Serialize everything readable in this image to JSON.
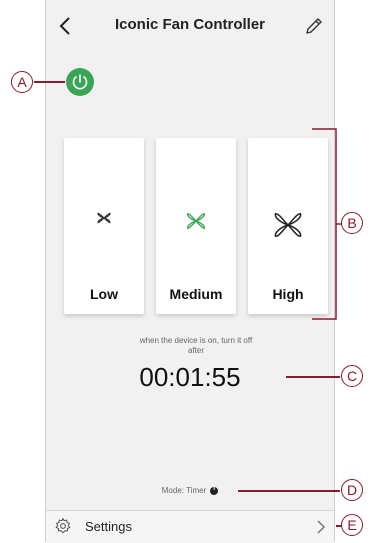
{
  "header": {
    "title": "Iconic Fan Controller",
    "back_icon": "chevron-left-icon",
    "edit_icon": "pencil-icon"
  },
  "power": {
    "icon": "power-icon",
    "state": "on",
    "color": "#3aa655"
  },
  "speeds": [
    {
      "label": "Low",
      "icon": "fan-low-icon",
      "color": "#333333",
      "selected": false
    },
    {
      "label": "Medium",
      "icon": "fan-medium-icon",
      "color": "#3aa655",
      "selected": true
    },
    {
      "label": "High",
      "icon": "fan-high-icon",
      "color": "#222222",
      "selected": false
    }
  ],
  "timer": {
    "note": "when the device is on, turn it off after",
    "value": "00:01:55"
  },
  "mode": {
    "text": "Mode: Timer",
    "icon": "info-icon"
  },
  "settings": {
    "label": "Settings",
    "icon": "gear-icon",
    "chevron": "chevron-right-icon"
  },
  "callouts": {
    "A": "A",
    "B": "B",
    "C": "C",
    "D": "D",
    "E": "E"
  },
  "colors": {
    "accent": "#3aa655",
    "callout": "#8b1a2b"
  }
}
